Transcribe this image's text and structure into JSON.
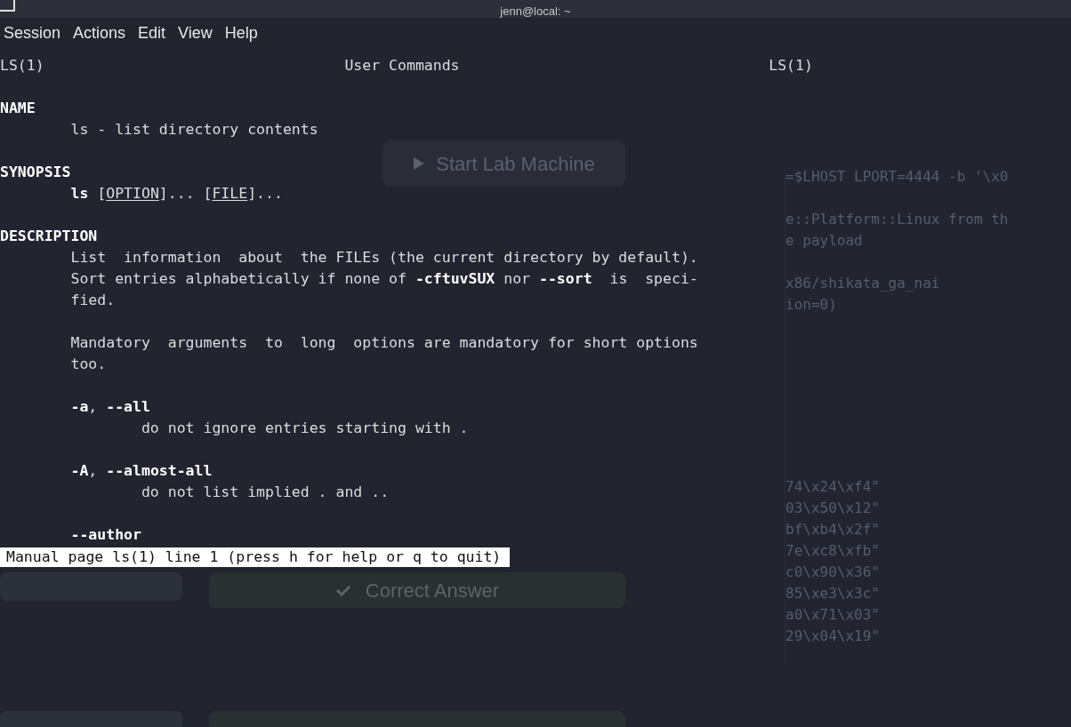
{
  "window": {
    "title": "jenn@local: ~"
  },
  "menu": [
    "Session",
    "Actions",
    "Edit",
    "View",
    "Help"
  ],
  "background": {
    "start_button": "Start Lab Machine",
    "answer_button": "Correct Answer",
    "code_blocks": [
      [
        "=$LHOST LPORT=4444 -b '\\x0"
      ],
      [
        "e::Platform::Linux from th",
        "e payload"
      ],
      [
        "x86/shikata_ga_nai",
        "ion=0)"
      ]
    ],
    "hex_lines": [
      "74\\x24\\xf4\"",
      "03\\x50\\x12\"",
      "bf\\xb4\\x2f\"",
      "7e\\xc8\\xfb\"",
      "c0\\x90\\x36\"",
      "85\\xe3\\x3c\"",
      "a0\\x71\\x03\"",
      "29\\x04\\x19\""
    ]
  },
  "man": {
    "header": {
      "left": "LS(1)",
      "center": "User Commands",
      "right": "LS(1)"
    },
    "blocks": [
      {
        "lines": [
          {
            "kind": "heading",
            "segments": [
              {
                "text": "NAME",
                "kind": "bold"
              }
            ]
          },
          {
            "kind": "body",
            "segments": [
              {
                "text": "ls - list directory contents",
                "kind": "plain"
              }
            ]
          }
        ]
      },
      {
        "lines": [
          {
            "kind": "heading",
            "segments": [
              {
                "text": "SYNOPSIS",
                "kind": "bold"
              }
            ]
          },
          {
            "kind": "body",
            "segments": [
              {
                "text": "ls",
                "kind": "bold"
              },
              {
                "text": " [",
                "kind": "plain"
              },
              {
                "text": "OPTION",
                "kind": "underline"
              },
              {
                "text": "]... [",
                "kind": "plain"
              },
              {
                "text": "FILE",
                "kind": "underline"
              },
              {
                "text": "]...",
                "kind": "plain"
              }
            ]
          }
        ]
      },
      {
        "lines": [
          {
            "kind": "heading",
            "segments": [
              {
                "text": "DESCRIPTION",
                "kind": "bold"
              }
            ]
          },
          {
            "kind": "body",
            "segments": [
              {
                "text": "List  information  about  the FILEs (the current directory by default).",
                "kind": "plain"
              }
            ]
          },
          {
            "kind": "body",
            "segments": [
              {
                "text": "Sort entries alphabetically if none of ",
                "kind": "plain"
              },
              {
                "text": "-cftuvSUX",
                "kind": "bold"
              },
              {
                "text": " nor ",
                "kind": "plain"
              },
              {
                "text": "--sort",
                "kind": "bold"
              },
              {
                "text": "  is  speci-",
                "kind": "plain"
              }
            ]
          },
          {
            "kind": "body",
            "segments": [
              {
                "text": "fied.",
                "kind": "plain"
              }
            ]
          }
        ]
      },
      {
        "lines": [
          {
            "kind": "body",
            "segments": [
              {
                "text": "Mandatory  arguments  to  long  options are mandatory for short options",
                "kind": "plain"
              }
            ]
          },
          {
            "kind": "body",
            "segments": [
              {
                "text": "too.",
                "kind": "plain"
              }
            ]
          }
        ]
      },
      {
        "lines": [
          {
            "kind": "body",
            "segments": [
              {
                "text": "-a",
                "kind": "bold"
              },
              {
                "text": ", ",
                "kind": "plain"
              },
              {
                "text": "--all",
                "kind": "bold"
              }
            ]
          },
          {
            "kind": "option",
            "segments": [
              {
                "text": "do not ignore entries starting with .",
                "kind": "plain"
              }
            ]
          }
        ]
      },
      {
        "lines": [
          {
            "kind": "body",
            "segments": [
              {
                "text": "-A",
                "kind": "bold"
              },
              {
                "text": ", ",
                "kind": "plain"
              },
              {
                "text": "--almost-all",
                "kind": "bold"
              }
            ]
          },
          {
            "kind": "option",
            "segments": [
              {
                "text": "do not list implied . and ..",
                "kind": "plain"
              }
            ]
          }
        ]
      },
      {
        "lines": [
          {
            "kind": "body",
            "segments": [
              {
                "text": "--author",
                "kind": "bold"
              }
            ]
          }
        ]
      }
    ],
    "status": "Manual page ls(1) line 1 (press h for help or q to quit)"
  }
}
